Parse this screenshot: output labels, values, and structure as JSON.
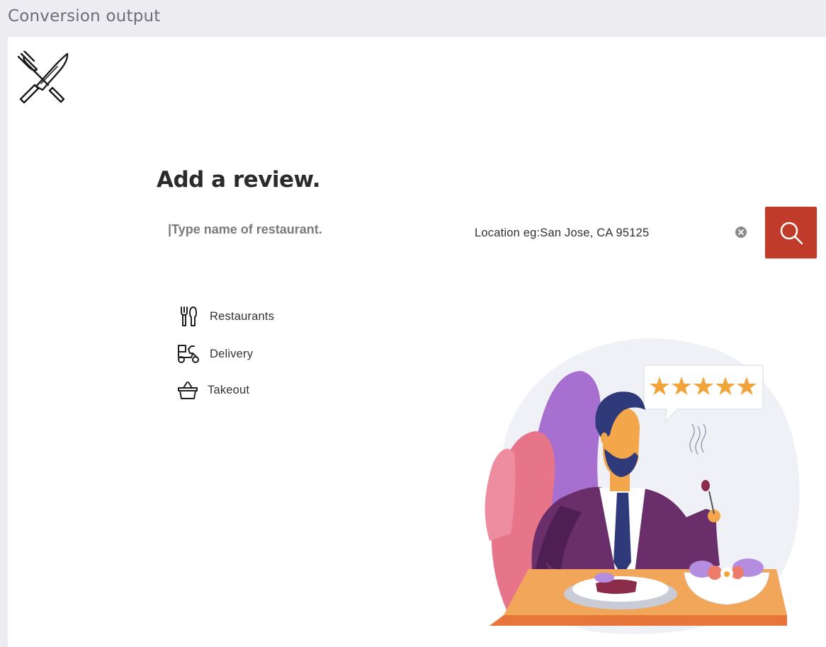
{
  "topbar": {
    "title": "Conversion output"
  },
  "logo": {
    "icon": "fork-knife-crossed-icon"
  },
  "review": {
    "heading": "Add a review.",
    "name_placeholder": "|Type name of restaurant.",
    "location_placeholder": "Location eg:San Jose, CA 95125"
  },
  "search": {
    "icon": "search-icon",
    "color": "#c13b2a"
  },
  "categories": [
    {
      "label": "Restaurants",
      "icon": "utensils-icon"
    },
    {
      "label": "Delivery",
      "icon": "scooter-icon"
    },
    {
      "label": "Takeout",
      "icon": "basket-icon"
    }
  ],
  "illustration": {
    "rating_stars": 5
  }
}
